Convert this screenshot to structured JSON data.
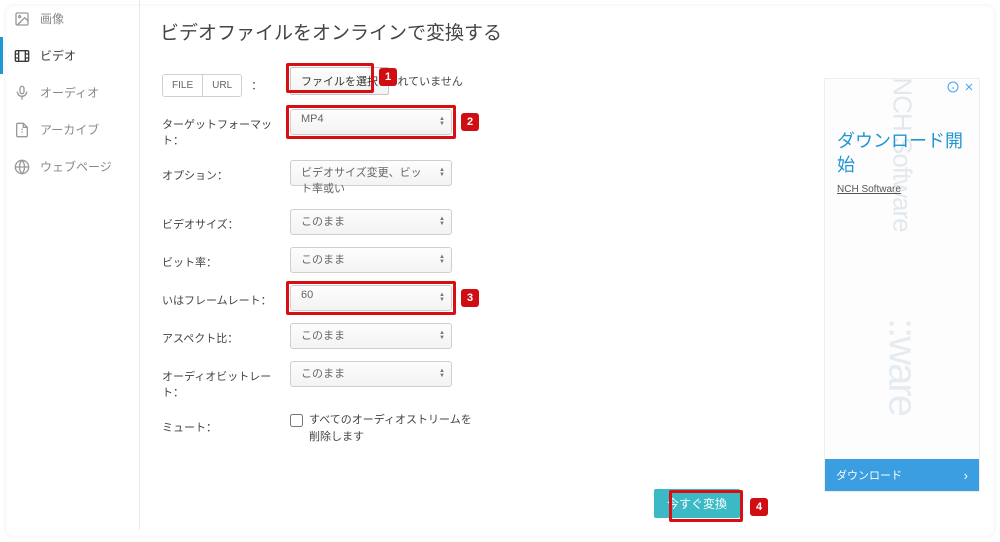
{
  "sidebar": {
    "items": [
      {
        "label": "画像",
        "icon": "image-icon"
      },
      {
        "label": "ビデオ",
        "icon": "video-icon"
      },
      {
        "label": "オーディオ",
        "icon": "audio-icon"
      },
      {
        "label": "アーカイブ",
        "icon": "archive-icon"
      },
      {
        "label": "ウェブページ",
        "icon": "webpage-icon"
      }
    ]
  },
  "main": {
    "title": "ビデオファイルをオンラインで変換する",
    "source": {
      "file_btn": "FILE",
      "url_btn": "URL",
      "colon": " ：",
      "choose_file": "ファイルを選択",
      "status_partial": "れていません"
    },
    "rows": {
      "target_format": {
        "label": "ターゲットフォーマット：",
        "value": "MP4"
      },
      "options": {
        "label": "オプション：",
        "value": "ビデオサイズ変更、ビット率或い"
      },
      "video_size": {
        "label": "ビデオサイズ：",
        "value": "このまま"
      },
      "bitrate": {
        "label": "ビット率：",
        "value": "このまま"
      },
      "framerate": {
        "label": "いはフレームレート：",
        "value": "60"
      },
      "aspect": {
        "label": "アスペクト比：",
        "value": "このまま"
      },
      "audio_bitrate": {
        "label": "オーディオビットレート：",
        "value": "このまま"
      },
      "mute": {
        "label": "ミュート：",
        "checkbox_label": "すべてのオーディオストリームを削除します"
      }
    },
    "convert_button": "今すぐ変換"
  },
  "ad": {
    "headline": "ダウンロード開始",
    "subtext": "NCH Software",
    "watermark1": "NCH Software",
    "watermark2": "::ware",
    "cta": "ダウンロード"
  },
  "annotations": {
    "b1": "1",
    "b2": "2",
    "b3": "3",
    "b4": "4"
  }
}
